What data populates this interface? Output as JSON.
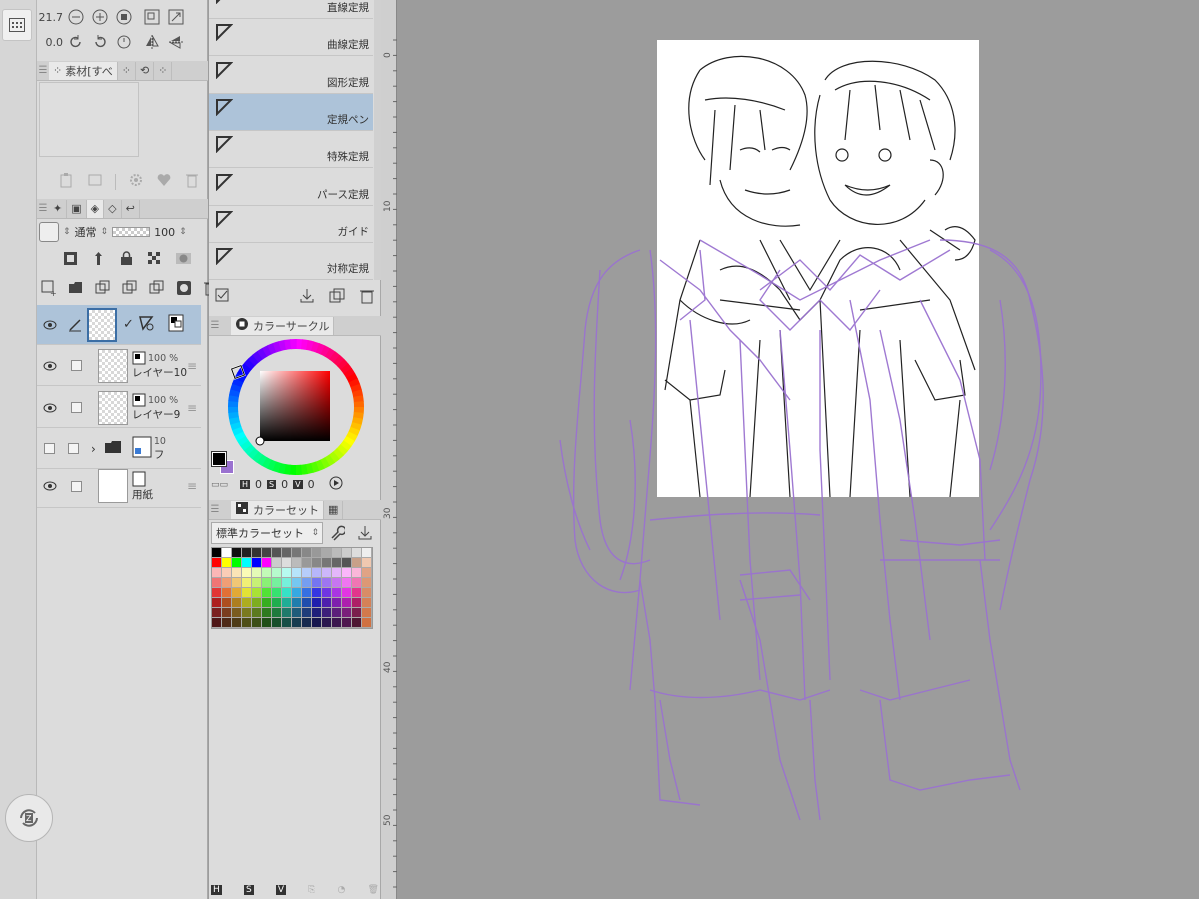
{
  "toolbar": {
    "zoom_value": "21.7",
    "rotate_value": "0.0"
  },
  "material_panel": {
    "tab_label": "素材[すべ"
  },
  "layer_panel": {
    "blend_mode": "通常",
    "opacity": "100",
    "layers": [
      {
        "name": "",
        "percent": "",
        "selected": true
      },
      {
        "name": "レイヤー10",
        "percent": "100 %",
        "selected": false
      },
      {
        "name": "レイヤー9",
        "percent": "100 %",
        "selected": false
      },
      {
        "name": "フ",
        "percent": "10",
        "selected": false
      },
      {
        "name": "用紙",
        "percent": "",
        "selected": false
      }
    ]
  },
  "ruler_tools": {
    "items": [
      "直線定規",
      "曲線定規",
      "図形定規",
      "定規ペン",
      "特殊定規",
      "パース定規",
      "ガイド",
      "対称定規"
    ],
    "selected": "定規ペン"
  },
  "color_circle": {
    "tab_label": "カラーサークル",
    "hsv_labels": [
      "H",
      "S",
      "V"
    ],
    "hsv_values": [
      "0",
      "0",
      "0"
    ],
    "main_color": "#000000",
    "sub_color": "#9a72d0",
    "hue_color": "#ff0000"
  },
  "color_set": {
    "tab_label": "カラーセット",
    "selected_set": "標準カラーセット"
  },
  "bottom_bar": {
    "labels": [
      "H",
      "S",
      "V"
    ]
  },
  "ruler_numbers": [
    "0",
    "10",
    "30",
    "40",
    "50"
  ],
  "colors": {
    "selection_blue": "#adc3d9",
    "sketch_purple": "#9a72d0"
  },
  "icons": [
    "calendar-grid-icon",
    "sync-icon",
    "zoom-out-icon",
    "zoom-in-icon",
    "fit-icon",
    "rotate-left-icon",
    "rotate-right-icon",
    "flip-horizontal-icon",
    "flip-vertical-icon",
    "eye-icon",
    "pen-icon",
    "folder-icon",
    "trash-icon",
    "heart-icon",
    "gear-icon",
    "wrench-icon",
    "download-icon"
  ]
}
